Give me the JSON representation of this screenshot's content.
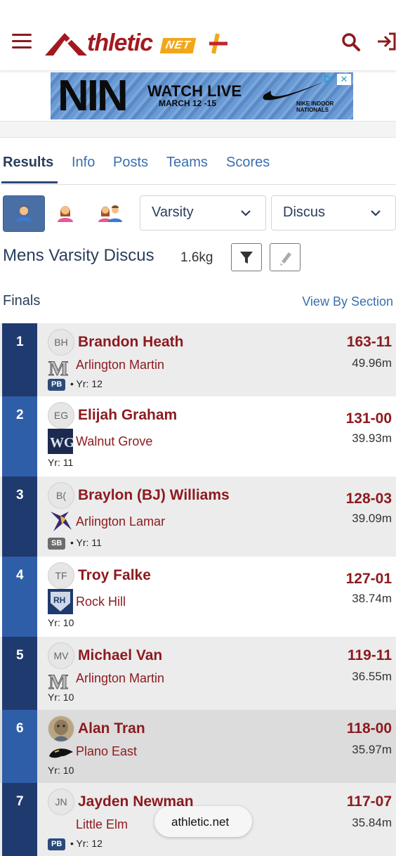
{
  "header": {
    "logo_word": "thletic",
    "logo_net": "NET"
  },
  "ad": {
    "brand": "NIN",
    "headline": "WATCH LIVE",
    "dates": "MARCH 12 -15",
    "line1": "NIKE INDOOR",
    "line2": "NATIONALS",
    "close_glyph": "✕"
  },
  "tabs": [
    {
      "label": "Results",
      "active": true
    },
    {
      "label": "Info"
    },
    {
      "label": "Posts"
    },
    {
      "label": "Teams"
    },
    {
      "label": "Scores"
    }
  ],
  "filters": {
    "level": "Varsity",
    "event": "Discus"
  },
  "event": {
    "title": "Mens Varsity Discus",
    "implement": "1.6kg"
  },
  "section": {
    "label": "Finals",
    "view_by": "View By Section"
  },
  "results": [
    {
      "place": "1",
      "initials": "BH",
      "name": "Brandon Heath",
      "school": "Arlington Martin",
      "badge": "PB",
      "year": "Yr: 12",
      "mark": "163-11",
      "metric": "49.96m"
    },
    {
      "place": "2",
      "initials": "EG",
      "name": "Elijah Graham",
      "school": "Walnut Grove",
      "badge": "",
      "year": "Yr: 11",
      "mark": "131-00",
      "metric": "39.93m"
    },
    {
      "place": "3",
      "initials": "B(",
      "name": "Braylon (BJ) Williams",
      "school": "Arlington Lamar",
      "badge": "SB",
      "year": "Yr: 11",
      "mark": "128-03",
      "metric": "39.09m"
    },
    {
      "place": "4",
      "initials": "TF",
      "name": "Troy Falke",
      "school": "Rock Hill",
      "badge": "",
      "year": "Yr: 10",
      "mark": "127-01",
      "metric": "38.74m"
    },
    {
      "place": "5",
      "initials": "MV",
      "name": "Michael Van",
      "school": "Arlington Martin",
      "badge": "",
      "year": "Yr: 10",
      "mark": "119-11",
      "metric": "36.55m"
    },
    {
      "place": "6",
      "initials": "",
      "name": "Alan Tran",
      "school": "Plano East",
      "badge": "",
      "year": "Yr: 10",
      "mark": "118-00",
      "metric": "35.97m"
    },
    {
      "place": "7",
      "initials": "JN",
      "name": "Jayden Newman",
      "school": "Little Elm",
      "badge": "PB",
      "year": "Yr: 12",
      "mark": "117-07",
      "metric": "35.84m"
    }
  ],
  "bottom_pill": "athletic.net",
  "colors": {
    "brand_red": "#8c1a1e",
    "navy": "#2a3e5c",
    "link_blue": "#3a6fae",
    "place_dark": "#1f3a6e",
    "place_light": "#2f5ea8"
  }
}
